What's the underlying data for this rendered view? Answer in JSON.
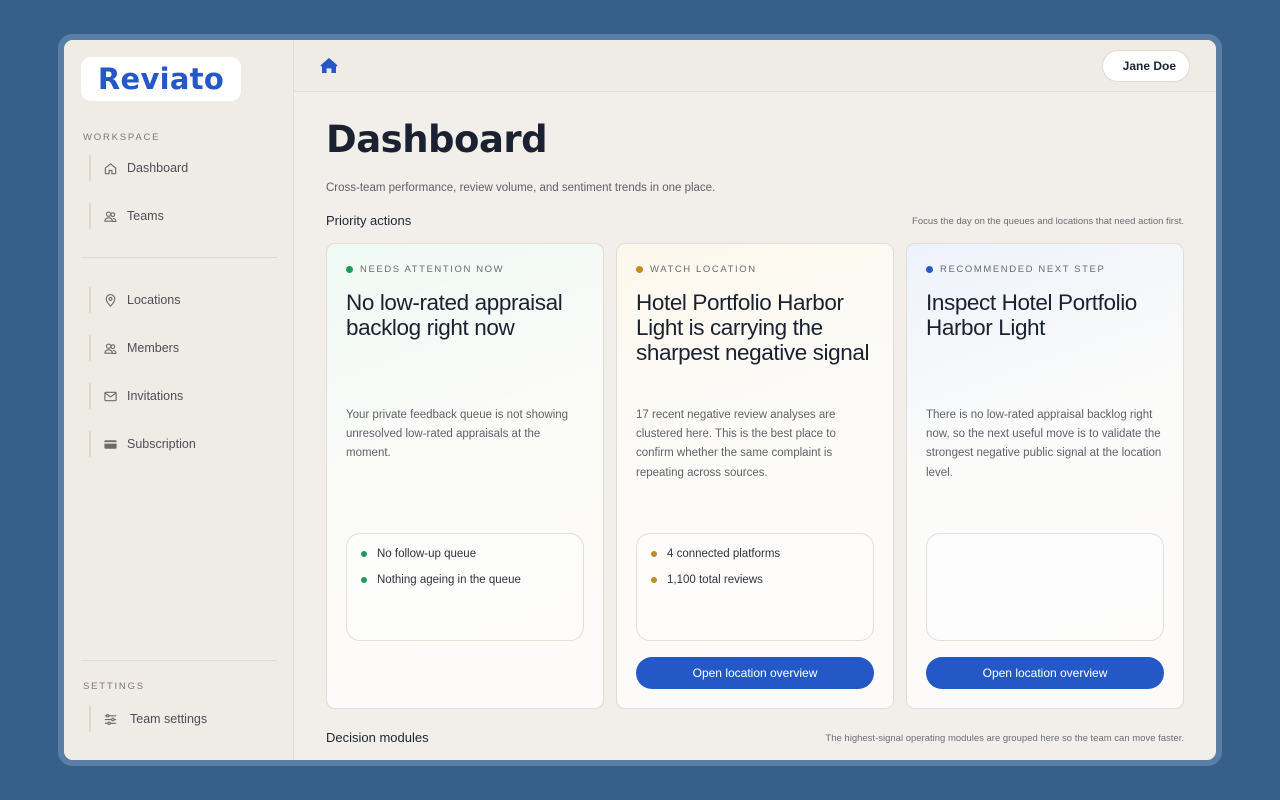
{
  "app": {
    "logo": "Reviato"
  },
  "sidebar": {
    "workspace_label": "WORKSPACE",
    "settings_label": "SETTINGS",
    "items": [
      {
        "label": "Dashboard",
        "icon": "home-icon"
      },
      {
        "label": "Teams",
        "icon": "users-icon"
      },
      {
        "label": "Locations",
        "icon": "map-pin-icon"
      },
      {
        "label": "Members",
        "icon": "members-icon"
      },
      {
        "label": "Invitations",
        "icon": "mail-icon"
      },
      {
        "label": "Subscription",
        "icon": "credit-card-icon"
      }
    ],
    "settings_items": [
      {
        "label": "Team settings",
        "icon": "sliders-icon"
      }
    ]
  },
  "topbar": {
    "user_name": "Jane Doe"
  },
  "page": {
    "title": "Dashboard",
    "subtitle": "Cross-team performance, review volume, and sentiment trends in one place."
  },
  "priority": {
    "title": "Priority actions",
    "hint": "Focus the day on the queues and locations that need action first.",
    "cards": [
      {
        "badge": "NEEDS ATTENTION NOW",
        "badge_color": "#1f9a5c",
        "title": "No low-rated appraisal backlog right now",
        "body": "Your private feedback queue is not showing unresolved low-rated appraisals at the moment.",
        "facts": [
          "No follow-up queue",
          "Nothing ageing in the queue"
        ],
        "cta": ""
      },
      {
        "badge": "WATCH LOCATION",
        "badge_color": "#c48a22",
        "title": "Hotel Portfolio Harbor Light is carrying the sharpest negative signal",
        "body": "17 recent negative review analyses are clustered here. This is the best place to confirm whether the same complaint is repeating across sources.",
        "facts": [
          "4 connected platforms",
          "1,100 total reviews"
        ],
        "cta": "Open location overview"
      },
      {
        "badge": "RECOMMENDED NEXT STEP",
        "badge_color": "#2458c7",
        "title": "Inspect Hotel Portfolio Harbor Light",
        "body": "There is no low-rated appraisal backlog right now, so the next useful move is to validate the strongest negative public signal at the location level.",
        "facts": [],
        "cta": "Open location overview"
      }
    ]
  },
  "decision": {
    "title": "Decision modules",
    "hint": "The highest-signal operating modules are grouped here so the team can move faster."
  },
  "colors": {
    "accent": "#2458c7",
    "background": "#36608a"
  }
}
